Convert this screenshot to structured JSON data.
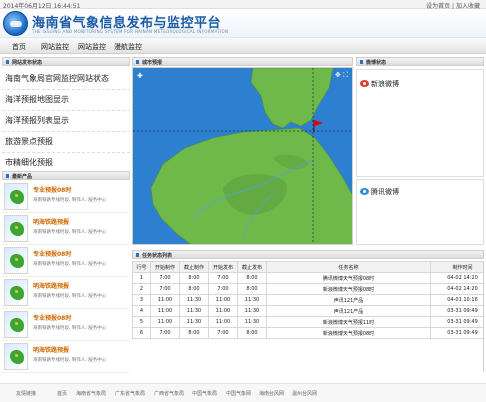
{
  "topbar": {
    "datetime": "2014年06月12日 16:44:51",
    "set_home": "设为首页",
    "separator": " | ",
    "add_favorite": "加入收藏"
  },
  "header": {
    "title": "海南省气象信息发布与监控平台",
    "subtitle": "THE ISSUING AND MONITORING SYSTEM FOR HAINAN METEOROLOGICAL INFORMATION"
  },
  "nav": {
    "items": [
      "首页",
      "网站监控",
      "网站监控",
      "漫航监控"
    ]
  },
  "left": {
    "section_title": "网站发布状态",
    "links": [
      "海南气象局官网监控网站状态",
      "海洋预报地图显示",
      "海洋预报列表显示",
      "旅游景点预报",
      "市精细化预报"
    ],
    "products_title": "最新产品",
    "products": [
      {
        "title": "专业预报08时",
        "sub": "海南铁路专线时段, 制作人: 服务中心"
      },
      {
        "title": "明海铁路预报",
        "sub": "海南铁路专线时段, 制作人: 服务中心"
      },
      {
        "title": "专业预报08时",
        "sub": "海南铁路专线时段, 制作人: 服务中心"
      },
      {
        "title": "明海铁路预报",
        "sub": "海南铁路专线时段, 制作人: 服务中心"
      },
      {
        "title": "专业预报08时",
        "sub": "海南铁路专线时段, 制作人: 服务中心"
      },
      {
        "title": "明海铁路预报",
        "sub": "海南铁路专线时段, 制作人: 服务中心"
      }
    ]
  },
  "map": {
    "section_title": "城市预报",
    "tool_icons": [
      "drag-icon",
      "fullscreen-icon"
    ]
  },
  "weibo": {
    "section_title": "微博状态",
    "sina": "新浪微博",
    "tencent": "腾讯微博"
  },
  "tasks": {
    "section_title": "任务状态列表",
    "columns": [
      "行号",
      "开始制作",
      "截止制作",
      "开始发布",
      "截止发布",
      "任务名称",
      "制作时间"
    ],
    "rows": [
      [
        "1",
        "7:00",
        "8:00",
        "7:00",
        "8:00",
        "腾讯微博天气预报08时",
        "04-02 14:20"
      ],
      [
        "2",
        "7:00",
        "8:00",
        "7:00",
        "8:00",
        "新浪微博天气预报08时",
        "04-02 14:20"
      ],
      [
        "3",
        "11:00",
        "11:30",
        "11:00",
        "11:30",
        "声讯121产品",
        "04-01 10:16"
      ],
      [
        "4",
        "11:00",
        "11:30",
        "11:00",
        "11:30",
        "声讯121产品",
        "03-31 09:49"
      ],
      [
        "5",
        "11:00",
        "11:30",
        "11:00",
        "11:30",
        "新浪微博天气预报11时",
        "03-31 09:49"
      ],
      [
        "6",
        "7:00",
        "8:00",
        "7:00",
        "8:00",
        "新浪微博天气预报08时",
        "03-31 09:49"
      ]
    ]
  },
  "footer": {
    "label": "友情链接",
    "links": [
      "首页",
      "海南省气象局",
      "广东省气象局",
      "广西省气象局",
      "中国气象局",
      "中国气象网",
      "海南台风网",
      "温州台风网"
    ]
  },
  "colors": {
    "title_blue": "#1b5aa6",
    "product_orange": "#d06a00",
    "sea_blue": "#2d7fd0",
    "land_green": "#6fb84a"
  }
}
